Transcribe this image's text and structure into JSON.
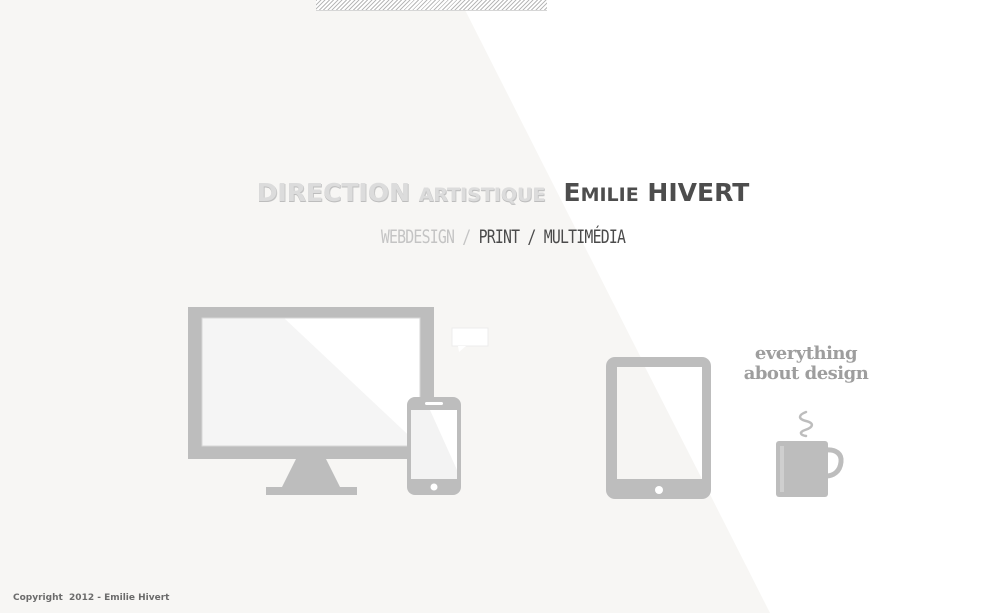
{
  "header": {
    "title_part1_big": "DIRECTION ",
    "title_part1_small": "ARTISTIQUE",
    "title_part2_first": "E",
    "title_part2_small": "MILIE",
    "title_part2_last": " HIVERT",
    "subtitle_webdesign": "WEBDESIGN",
    "subtitle_sep1": " / ",
    "subtitle_print": "PRINT / MULTIMÉDIA"
  },
  "tagline": {
    "line1": "everything",
    "line2": "about design"
  },
  "footer": {
    "copyright": "Copyright  2012 - Emilie Hivert"
  },
  "colors": {
    "background": "#ffffff",
    "panel": "#f7f6f4",
    "device_gray": "#bdbdbd",
    "dark_text": "#4d4d4d"
  },
  "icons": [
    "monitor-icon",
    "smartphone-icon",
    "speech-bubble-icon",
    "tablet-icon",
    "coffee-cup-icon"
  ]
}
